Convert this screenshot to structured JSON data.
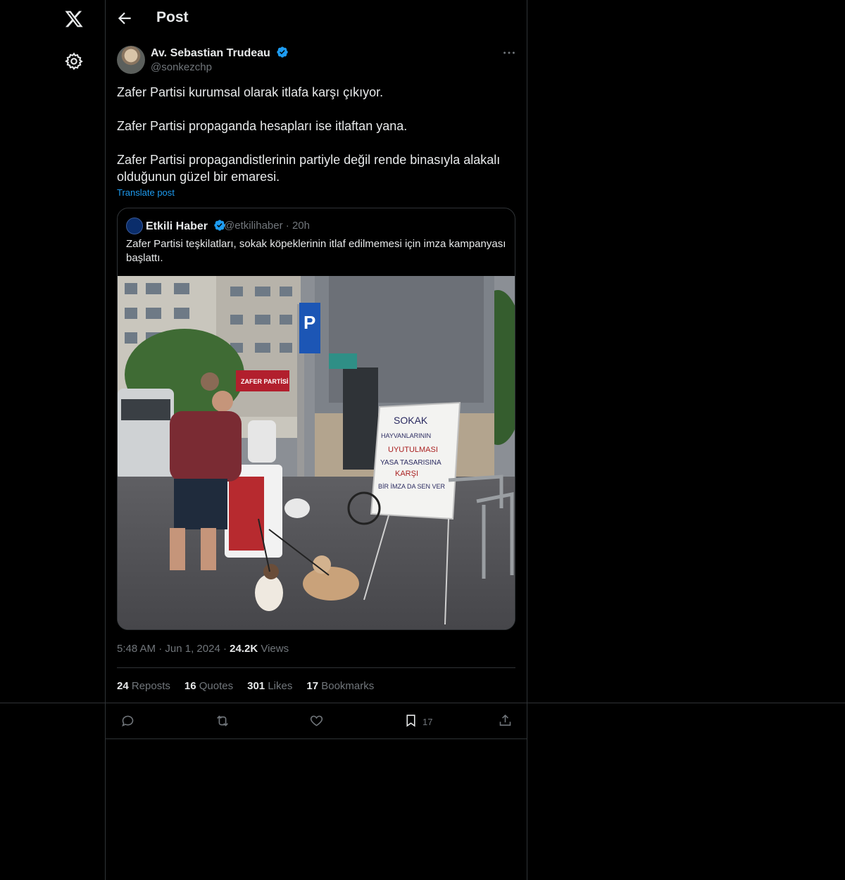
{
  "header": {
    "title": "Post"
  },
  "post": {
    "author_name": "Av. Sebastian Trudeau",
    "author_handle": "@sonkezchp",
    "paragraphs": [
      "Zafer Partisi kurumsal olarak itlafa karşı çıkıyor.",
      "Zafer Partisi propaganda hesapları ise itlaftan yana.",
      "Zafer Partisi propagandistlerinin partiyle değil rende binasıyla alakalı olduğunun güzel bir emaresi."
    ],
    "translate_label": "Translate post",
    "time": "5:48 AM",
    "date": "Jun 1, 2024",
    "views_count": "24.2K",
    "views_label": "Views"
  },
  "quote": {
    "author_name": "Etkili Haber",
    "author_handle": "@etkilihaber",
    "age": "20h",
    "text": "Zafer Partisi teşkilatları, sokak köpeklerinin itlaf edilmemesi için imza kampanyası başlattı.",
    "image_banner": "ZAFER PARTİSİ",
    "sign_lines": [
      "SOKAK",
      "HAYVANLARININ",
      "UYUTULMASI",
      "YASA TASARISINA",
      "KARŞI",
      "BİR İMZA DA SEN VER"
    ]
  },
  "stats": {
    "reposts_count": "24",
    "reposts_label": "Reposts",
    "quotes_count": "16",
    "quotes_label": "Quotes",
    "likes_count": "301",
    "likes_label": "Likes",
    "bookmarks_count": "17",
    "bookmarks_label": "Bookmarks"
  },
  "actions": {
    "bookmark_count": "17"
  },
  "colors": {
    "accent": "#1d9bf0",
    "muted": "#71767b",
    "border": "#2f3336"
  }
}
